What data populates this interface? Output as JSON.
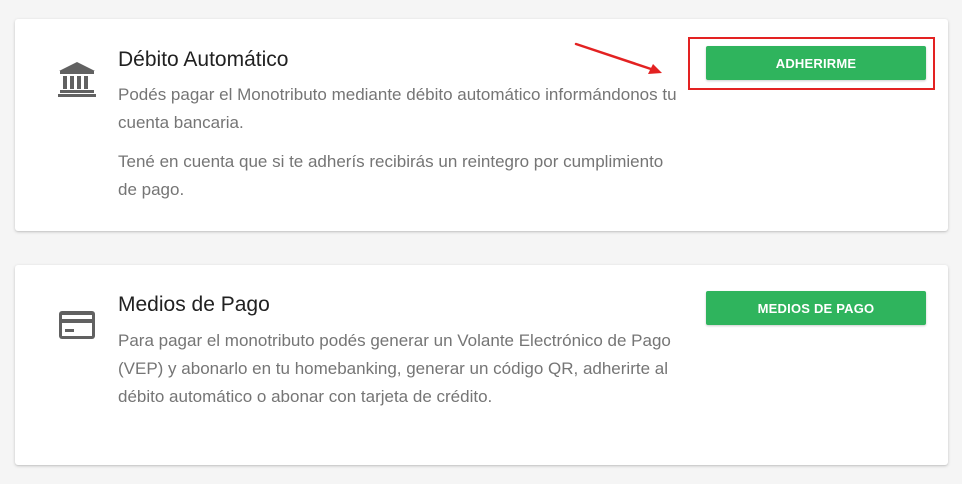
{
  "debito": {
    "icon": "bank-icon",
    "title": "Débito Automático",
    "text1": "Podés pagar el Monotributo mediante débito automático informándonos tu cuenta bancaria.",
    "text2": "Tené en cuenta que si te adherís recibirás un reintegro por cumplimiento de pago.",
    "button_label": "ADHERIRME"
  },
  "medios": {
    "icon": "credit-card-icon",
    "title": "Medios de Pago",
    "text1": "Para pagar el monotributo podés generar un Volante Electrónico de Pago (VEP) y abonarlo en tu homebanking, generar un código QR, adherirte al débito automático o abonar con tarjeta de crédito.",
    "button_label": "MEDIOS DE PAGO"
  },
  "colors": {
    "button_green": "#2fb45d",
    "annotation_red": "#e32222",
    "icon_gray": "#616161"
  }
}
